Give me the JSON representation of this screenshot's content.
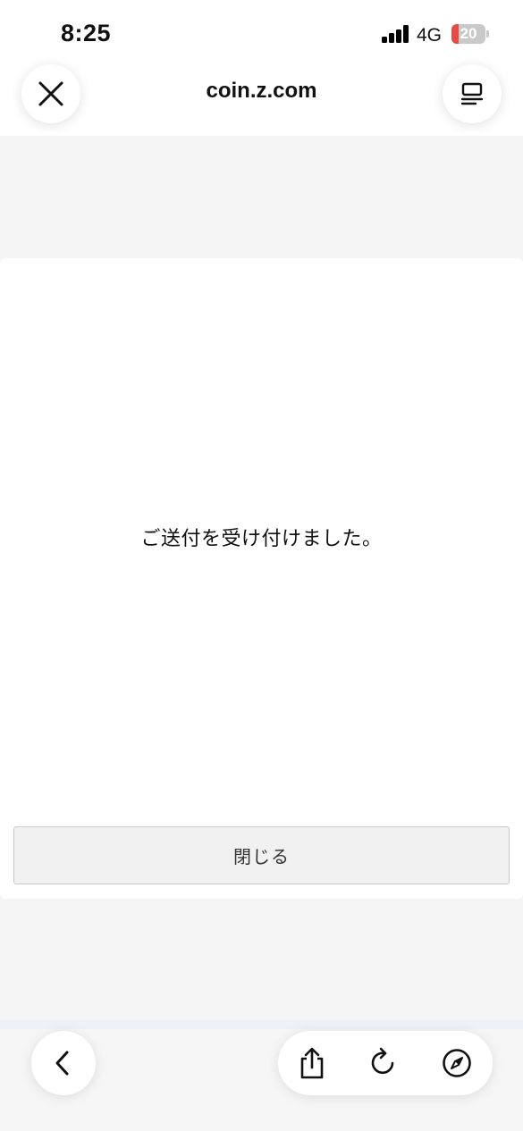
{
  "status_bar": {
    "time": "8:25",
    "network": "4G",
    "battery_level": "20",
    "battery_fraction": 0.2,
    "battery_color": "#e94b42"
  },
  "browser": {
    "url": "coin.z.com",
    "close_icon": "close-icon",
    "tabs_icon": "tabs-menu-icon"
  },
  "modal": {
    "message": "ご送付を受け付けました。",
    "close_button_label": "閉じる"
  },
  "toolbar": {
    "back_icon": "chevron-left-icon",
    "share_icon": "share-icon",
    "reload_icon": "reload-icon",
    "compass_icon": "compass-icon"
  }
}
